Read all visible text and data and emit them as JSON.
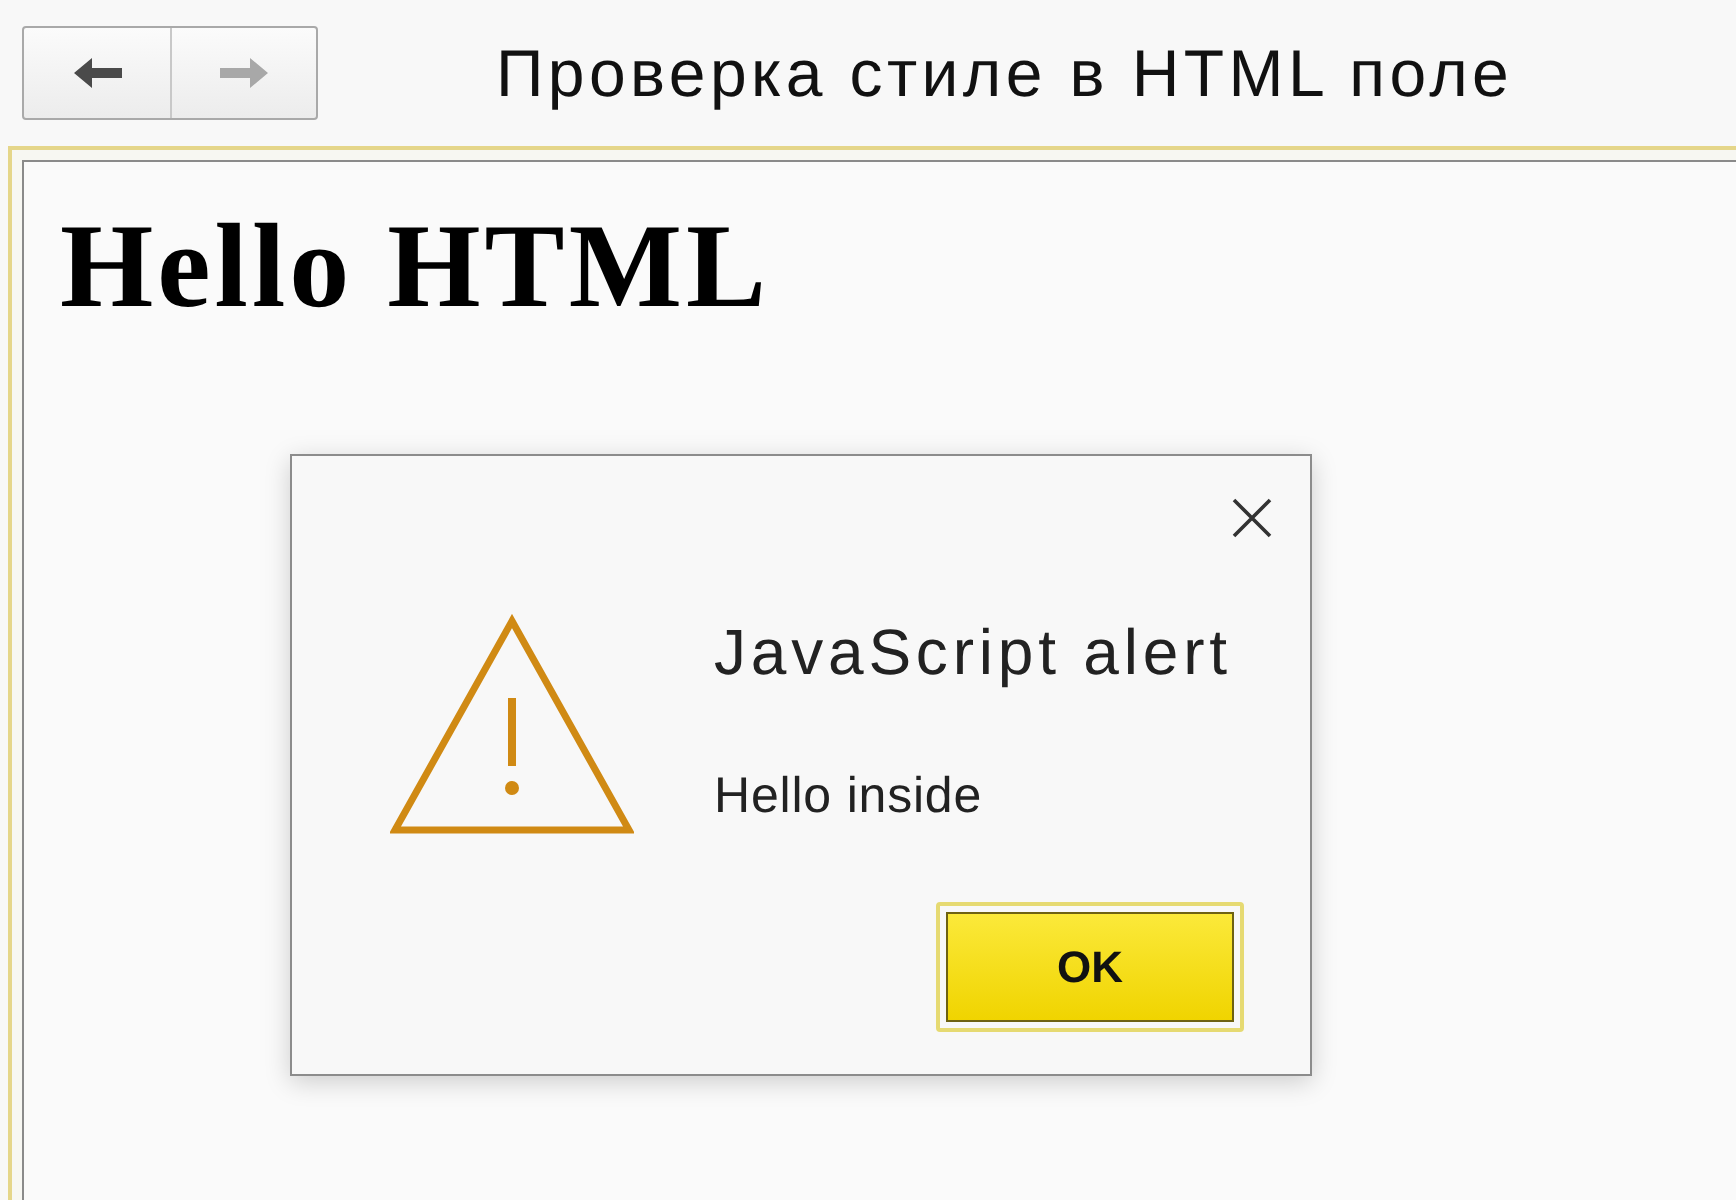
{
  "toolbar": {
    "nav_buttons": [
      {
        "kind": "back",
        "disabled": false
      },
      {
        "kind": "forward",
        "disabled": true
      }
    ],
    "title": "Проверка стиле в HTML поле"
  },
  "document": {
    "heading": "Hello HTML"
  },
  "dialog": {
    "title": "JavaScript alert",
    "message": "Hello inside",
    "buttons": [
      {
        "label": "OK",
        "focused": true
      }
    ]
  }
}
